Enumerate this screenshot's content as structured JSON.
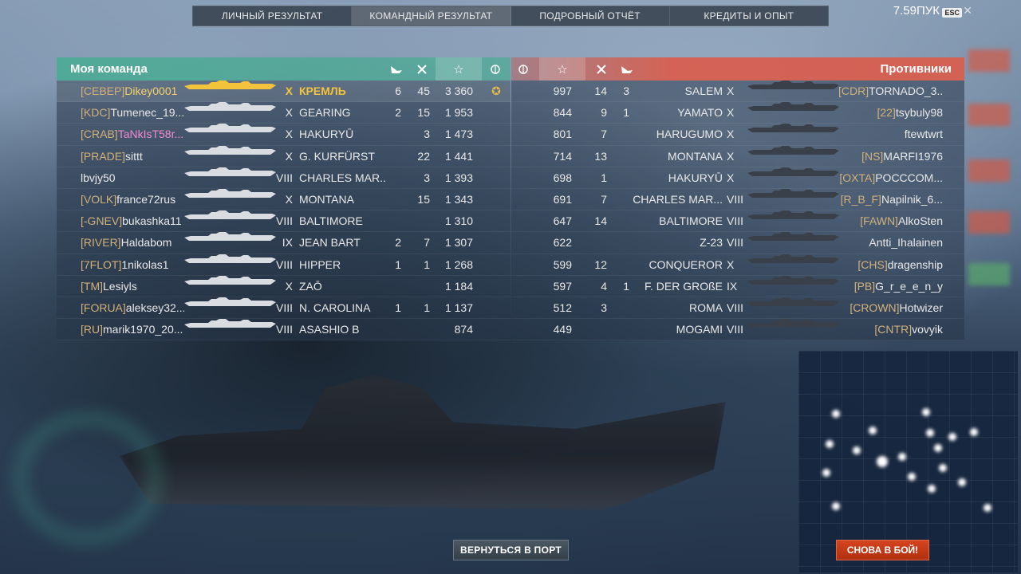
{
  "tabs": [
    {
      "label": "ЛИЧНЫЙ РЕЗУЛЬТАТ"
    },
    {
      "label": "КОМАНДНЫЙ РЕЗУЛЬТАТ"
    },
    {
      "label": "ПОДРОБНЫЙ ОТЧЁТ"
    },
    {
      "label": "КРЕДИТЫ И ОПЫТ"
    }
  ],
  "active_tab": 1,
  "version": "7.59ПУК",
  "esc_label": "ESC",
  "close_glyph": "✕",
  "my_team": {
    "title": "Моя команда",
    "icons": {
      "planes": "plane-down-icon",
      "frags": "crossed-swords-icon",
      "xp": "star-icon",
      "medal": "laurel-icon"
    },
    "rows": [
      {
        "clan": "[СЕВЕР]",
        "name": "Dikey0001",
        "tier": "X",
        "ship": "КРЕМЛЬ",
        "planes": "6",
        "frags": "45",
        "xp": "3 360",
        "medal": "✪",
        "me": true
      },
      {
        "clan": "[KDC]",
        "name": "Tumenec_19...",
        "tier": "X",
        "ship": "GEARING",
        "planes": "2",
        "frags": "15",
        "xp": "1 953",
        "medal": ""
      },
      {
        "clan": "[CRAB]",
        "name": "TaNkIsT58r...",
        "tier": "X",
        "ship": "HAKURYŪ",
        "planes": "",
        "frags": "3",
        "xp": "1 473",
        "medal": "",
        "pink": true
      },
      {
        "clan": "[PRADE]",
        "name": "sittt",
        "tier": "X",
        "ship": "G. KURFÜRST",
        "planes": "",
        "frags": "22",
        "xp": "1 441",
        "medal": ""
      },
      {
        "clan": "",
        "name": "lbvjy50",
        "tier": "VIII",
        "ship": "CHARLES MAR...",
        "planes": "",
        "frags": "3",
        "xp": "1 393",
        "medal": ""
      },
      {
        "clan": "[VOLK]",
        "name": "france72rus",
        "tier": "X",
        "ship": "MONTANA",
        "planes": "",
        "frags": "15",
        "xp": "1 343",
        "medal": ""
      },
      {
        "clan": "[-GNEV]",
        "name": "bukashka11",
        "tier": "VIII",
        "ship": "BALTIMORE",
        "planes": "",
        "frags": "",
        "xp": "1 310",
        "medal": ""
      },
      {
        "clan": "[RIVER]",
        "name": "Haldabom",
        "tier": "IX",
        "ship": "JEAN BART",
        "planes": "2",
        "frags": "7",
        "xp": "1 307",
        "medal": ""
      },
      {
        "clan": "[7FLOT]",
        "name": "1nikolas1",
        "tier": "VIII",
        "ship": "HIPPER",
        "planes": "1",
        "frags": "1",
        "xp": "1 268",
        "medal": ""
      },
      {
        "clan": "[TM]",
        "name": "Lesiyls",
        "tier": "X",
        "ship": "ZAŌ",
        "planes": "",
        "frags": "",
        "xp": "1 184",
        "medal": ""
      },
      {
        "clan": "[FORUA]",
        "name": "aleksey32...",
        "tier": "VIII",
        "ship": "N. CAROLINA",
        "planes": "1",
        "frags": "1",
        "xp": "1 137",
        "medal": ""
      },
      {
        "clan": "[RU]",
        "name": "marik1970_20...",
        "tier": "VIII",
        "ship": "ASASHIO B",
        "planes": "",
        "frags": "",
        "xp": "874",
        "medal": ""
      }
    ]
  },
  "enemy_team": {
    "title": "Противники",
    "icons": {
      "medal": "laurel-icon",
      "xp": "star-icon",
      "frags": "crossed-swords-icon",
      "planes": "plane-down-icon"
    },
    "rows": [
      {
        "xp": "997",
        "frags": "14",
        "planes": "3",
        "ship": "SALEM",
        "tier": "X",
        "clan": "[CDR]",
        "name": "TORNADO_3..."
      },
      {
        "xp": "844",
        "frags": "9",
        "planes": "1",
        "ship": "YAMATO",
        "tier": "X",
        "clan": "[22]",
        "name": "tsybuly98"
      },
      {
        "xp": "801",
        "frags": "7",
        "planes": "",
        "ship": "HARUGUMO",
        "tier": "X",
        "clan": "",
        "name": "ftewtwrt"
      },
      {
        "xp": "714",
        "frags": "13",
        "planes": "",
        "ship": "MONTANA",
        "tier": "X",
        "clan": "[NS]",
        "name": "MARFI1976"
      },
      {
        "xp": "698",
        "frags": "1",
        "planes": "",
        "ship": "HAKURYŪ",
        "tier": "X",
        "clan": "[OXTA]",
        "name": "POCCCOM..."
      },
      {
        "xp": "691",
        "frags": "7",
        "planes": "",
        "ship": "CHARLES MAR...",
        "tier": "VIII",
        "clan": "[R_B_F]",
        "name": "Napilnik_6..."
      },
      {
        "xp": "647",
        "frags": "14",
        "planes": "",
        "ship": "BALTIMORE",
        "tier": "VIII",
        "clan": "[FAWN]",
        "name": "AlkoSten"
      },
      {
        "xp": "622",
        "frags": "",
        "planes": "",
        "ship": "Z-23",
        "tier": "VIII",
        "clan": "",
        "name": "Antti_Ihalainen"
      },
      {
        "xp": "599",
        "frags": "12",
        "planes": "",
        "ship": "CONQUEROR",
        "tier": "X",
        "clan": "[CHS]",
        "name": "dragenship"
      },
      {
        "xp": "597",
        "frags": "4",
        "planes": "1",
        "ship": "F. DER GROßE",
        "tier": "IX",
        "clan": "[PB]",
        "name": "G_r_e_e_n_y"
      },
      {
        "xp": "512",
        "frags": "3",
        "planes": "",
        "ship": "ROMA",
        "tier": "VIII",
        "clan": "[CROWN]",
        "name": "Hotwizer"
      },
      {
        "xp": "449",
        "frags": "",
        "planes": "",
        "ship": "MOGAMI",
        "tier": "VIII",
        "clan": "[CNTR]",
        "name": "vovyik"
      }
    ]
  },
  "buttons": {
    "back_to_port": "ВЕРНУТЬСЯ В ПОРТ",
    "battle_again": "СНОВА В БОЙ!"
  }
}
